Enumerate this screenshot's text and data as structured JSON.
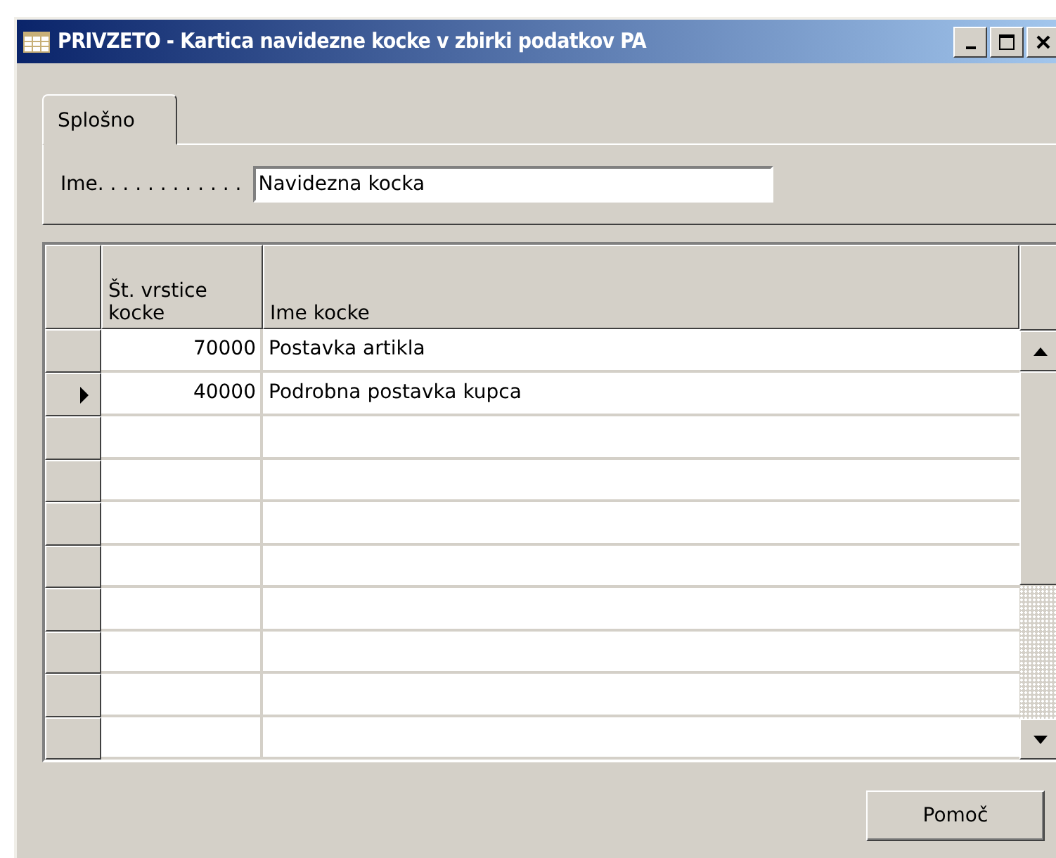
{
  "window": {
    "title": "PRIVZETO - Kartica navidezne kocke v zbirki podatkov PA"
  },
  "tabs": [
    {
      "label": "Splošno",
      "selected": true
    }
  ],
  "fields": [
    {
      "label": "Ime. . . . . . . . . . . .",
      "value": "Navidezna kocka"
    }
  ],
  "table": {
    "columns": [
      "Št. vrstice kocke",
      "Ime kocke"
    ],
    "rows": [
      {
        "selected": false,
        "cells": [
          "70000",
          "Postavka artikla"
        ]
      },
      {
        "selected": true,
        "cells": [
          "40000",
          "Podrobna postavka kupca"
        ]
      },
      {
        "selected": false
      },
      {
        "selected": false
      },
      {
        "selected": false
      },
      {
        "selected": false
      },
      {
        "selected": false
      },
      {
        "selected": false
      },
      {
        "selected": false
      },
      {
        "selected": false
      }
    ]
  },
  "buttons": [
    "Pomoč"
  ]
}
